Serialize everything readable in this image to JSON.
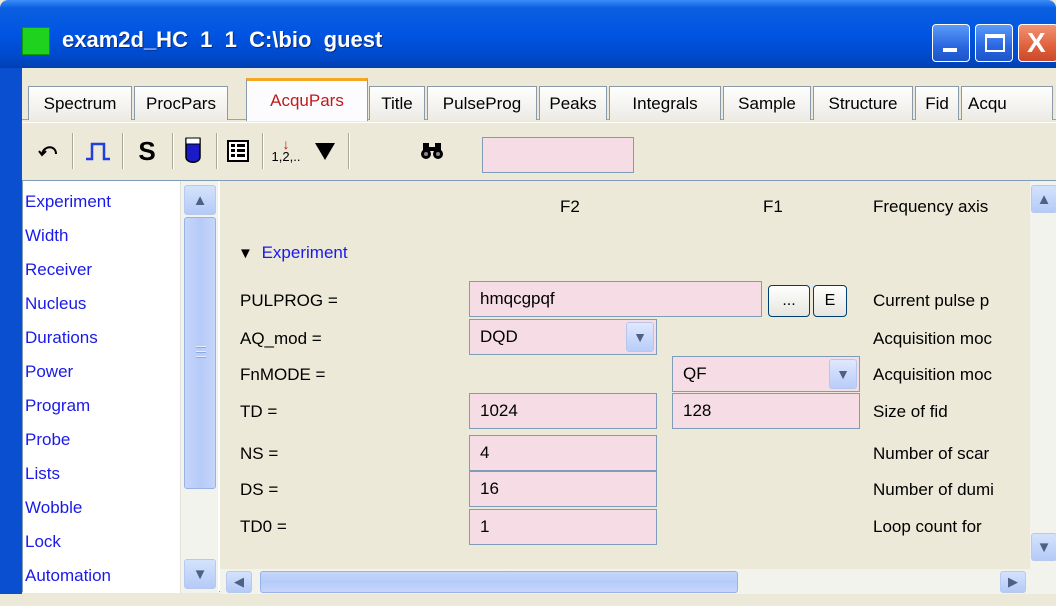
{
  "window": {
    "title": "exam2d_HC  1  1  C:\\bio  guest",
    "min_label": "",
    "max_label": "",
    "close_label": "X"
  },
  "tabs": [
    {
      "label": "Spectrum"
    },
    {
      "label": "ProcPars"
    },
    {
      "label": "AcquPars",
      "active": true
    },
    {
      "label": "Title"
    },
    {
      "label": "PulseProg"
    },
    {
      "label": "Peaks"
    },
    {
      "label": "Integrals"
    },
    {
      "label": "Sample"
    },
    {
      "label": "Structure"
    },
    {
      "label": "Fid"
    },
    {
      "label": "Acqu"
    }
  ],
  "toolbar": {
    "undo_icon": "undo-icon",
    "pulse_icon": "pulse-icon",
    "s_label": "S",
    "tube_icon": "sample-tube-icon",
    "table_icon": "table-icon",
    "sort_label": "1,2,..",
    "filter_icon": "filter-triangle-icon",
    "find_icon": "binoculars-icon",
    "search_value": ""
  },
  "sidebar": {
    "items": [
      {
        "label": "Experiment"
      },
      {
        "label": "Width"
      },
      {
        "label": "Receiver"
      },
      {
        "label": "Nucleus"
      },
      {
        "label": "Durations"
      },
      {
        "label": "Power"
      },
      {
        "label": "Program"
      },
      {
        "label": "Probe"
      },
      {
        "label": "Lists"
      },
      {
        "label": "Wobble"
      },
      {
        "label": "Lock"
      },
      {
        "label": "Automation"
      }
    ]
  },
  "header": {
    "f2": "F2",
    "f1": "F1",
    "description": "Frequency axis"
  },
  "section": {
    "label": "Experiment"
  },
  "params": {
    "pulprog": {
      "label": "PULPROG =",
      "value": "hmqcgpqf",
      "browse_label": "...",
      "edit_label": "E",
      "desc": "Current pulse p"
    },
    "aq_mod": {
      "label": "AQ_mod =",
      "value": "DQD",
      "desc": "Acquisition moc"
    },
    "fnmode": {
      "label": "FnMODE =",
      "value": "QF",
      "desc": "Acquisition moc"
    },
    "td": {
      "label": "TD =",
      "value_f2": "1024",
      "value_f1": "128",
      "desc": "Size of fid"
    },
    "ns": {
      "label": "NS =",
      "value": "4",
      "desc": "Number of scar"
    },
    "ds": {
      "label": "DS =",
      "value": "16",
      "desc": "Number of dumi"
    },
    "td0": {
      "label": "TD0 =",
      "value": "1",
      "desc": "Loop count for"
    }
  },
  "colors": {
    "field_bg": "#f6dde5",
    "link_blue": "#1a1ae8",
    "active_tab_text": "#c11a1a"
  }
}
